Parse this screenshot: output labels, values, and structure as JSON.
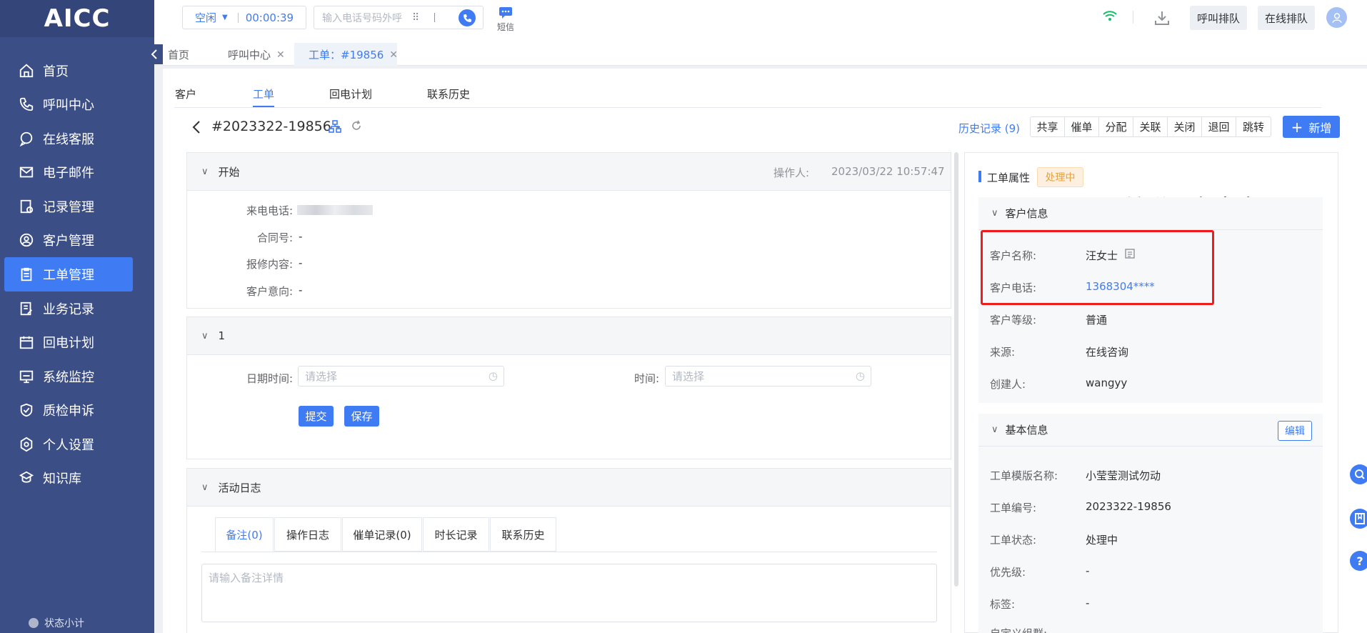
{
  "app": {
    "logo": "AICC"
  },
  "sidebar": {
    "items": [
      {
        "label": "首页",
        "icon": "home-icon"
      },
      {
        "label": "呼叫中心",
        "icon": "phone-icon"
      },
      {
        "label": "在线客服",
        "icon": "chat-icon"
      },
      {
        "label": "电子邮件",
        "icon": "mail-icon"
      },
      {
        "label": "记录管理",
        "icon": "record-icon"
      },
      {
        "label": "客户管理",
        "icon": "user-icon"
      },
      {
        "label": "工单管理",
        "icon": "ticket-icon",
        "active": true
      },
      {
        "label": "业务记录",
        "icon": "business-icon"
      },
      {
        "label": "回电计划",
        "icon": "calendar-icon"
      },
      {
        "label": "系统监控",
        "icon": "monitor-icon"
      },
      {
        "label": "质检申诉",
        "icon": "shield-icon"
      },
      {
        "label": "个人设置",
        "icon": "settings-icon"
      },
      {
        "label": "知识库",
        "icon": "book-icon"
      }
    ],
    "status": "状态小计"
  },
  "topbar": {
    "agent_status": "空闲",
    "timer": "00:00:39",
    "dial_placeholder": "输入电话号码外呼",
    "sms_label": "短信",
    "call_queue": "呼叫排队",
    "online_queue": "在线排队"
  },
  "page_tabs": [
    {
      "label": "首页"
    },
    {
      "label": "呼叫中心"
    },
    {
      "label": "工单：#19856"
    }
  ],
  "sub_tabs": [
    "客户",
    "工单",
    "回电计划",
    "联系历史"
  ],
  "ticket": {
    "title": "#2023322-19856 -",
    "history": "历史记录 (9)",
    "actions": [
      "共享",
      "催单",
      "分配",
      "关联",
      "关闭",
      "退回",
      "跳转"
    ],
    "new_label": "新增"
  },
  "start_section": {
    "title": "开始",
    "operator_label": "操作人:",
    "datetime": "2023/03/22 10:57:47",
    "fields": [
      {
        "label": "来电电话:",
        "value": ""
      },
      {
        "label": "合同号:",
        "value": "-"
      },
      {
        "label": "报修内容:",
        "value": "-"
      },
      {
        "label": "客户意向:",
        "value": "-"
      }
    ]
  },
  "step_section": {
    "title": "1",
    "date_label": "日期时间:",
    "date_placeholder": "请选择",
    "time_label": "时间:",
    "time_placeholder": "请选择",
    "submit": "提交",
    "save": "保存"
  },
  "activity": {
    "title": "活动日志",
    "tabs": [
      "备注(0)",
      "操作日志",
      "催单记录(0)",
      "时长记录",
      "联系历史"
    ],
    "note_placeholder": "请输入备注详情"
  },
  "props": {
    "title": "工单属性",
    "status_badge": "处理中",
    "annotation": "关联已有客户",
    "customer": {
      "title": "客户信息",
      "rows": [
        {
          "label": "客户名称:",
          "value": "汪女士"
        },
        {
          "label": "客户电话:",
          "value": "1368304****"
        },
        {
          "label": "客户等级:",
          "value": "普通"
        },
        {
          "label": "来源:",
          "value": "在线咨询"
        },
        {
          "label": "创建人:",
          "value": "wangyy"
        }
      ]
    },
    "basic": {
      "title": "基本信息",
      "edit": "编辑",
      "rows": [
        {
          "label": "工单模版名称:",
          "value": "小莹莹测试勿动"
        },
        {
          "label": "工单编号:",
          "value": "2023322-19856"
        },
        {
          "label": "工单状态:",
          "value": "处理中"
        },
        {
          "label": "优先级:",
          "value": "-"
        },
        {
          "label": "标签:",
          "value": "-"
        },
        {
          "label": "自定义组群:",
          "value": ""
        }
      ]
    }
  },
  "colors": {
    "accent": "#3f7cf4",
    "sidebar": "#3c4e86",
    "annotation": "#ee1c1c",
    "badge_bg": "#fdf0e1",
    "badge_fg": "#e6a23c"
  }
}
